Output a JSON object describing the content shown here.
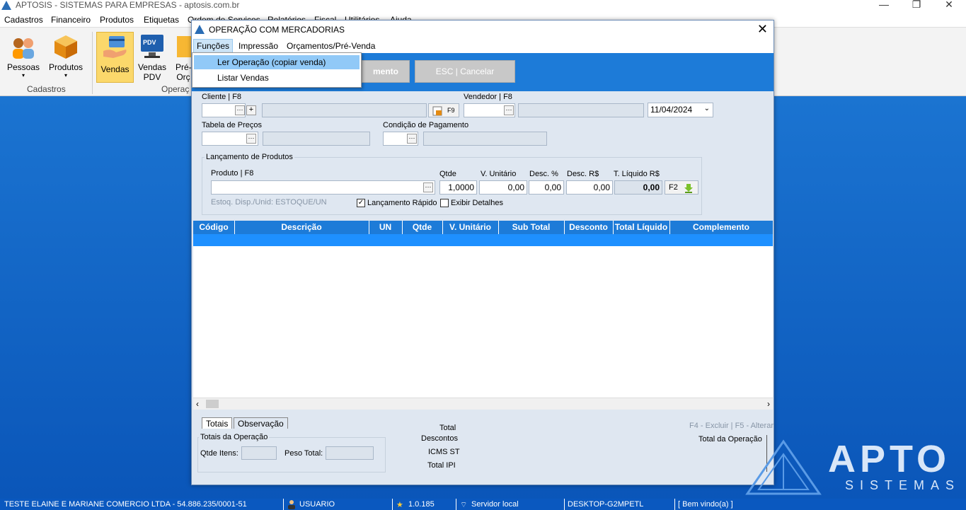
{
  "window": {
    "title": "APTOSIS - SISTEMAS PARA EMPRESAS - aptosis.com.br"
  },
  "menubar": [
    "Cadastros",
    "Financeiro",
    "Produtos",
    "Etiquetas",
    "Ordem de Serviços",
    "Relatórios",
    "Fiscal",
    "Utilitários",
    "Ajuda"
  ],
  "ribbon": {
    "buttons": [
      "Pessoas",
      "Produtos",
      "Vendas",
      "Vendas",
      "PDV",
      "Pré-",
      "Orç"
    ],
    "pdv_icon_text": "PDV",
    "groups": [
      "Cadastros",
      "Operaç"
    ]
  },
  "dialog": {
    "title": "OPERAÇÃO COM MERCADORIAS",
    "menu": [
      "Funções",
      "Impressão",
      "Orçamentos/Pré-Venda"
    ],
    "dropdown": [
      "Ler Operação (copiar venda)",
      "Listar Vendas"
    ],
    "buttons": {
      "payment": "mento",
      "cancel": "ESC | Cancelar"
    },
    "labels": {
      "cliente": "Cliente | F8",
      "vendedor": "Vendedor | F8",
      "tabela": "Tabela de Preços",
      "condicao": "Condição de Pagamento",
      "lancamento": "Lançamento de Produtos",
      "produto": "Produto | F8",
      "qtde": "Qtde",
      "vunit": "V. Unitário",
      "descpct": "Desc. %",
      "descrs": "Desc. R$",
      "tliq": "T. Líquido R$",
      "estoque": "Estoq. Disp./Unid: ESTOQUE/UN",
      "lanc_rapido": "Lançamento Rápido",
      "exibir": "Exibir Detalhes",
      "f9": "F9",
      "f2": "F2",
      "plus": "+",
      "ellipsis": "···"
    },
    "date": "11/04/2024",
    "values": {
      "qtde": "1,0000",
      "vunit": "0,00",
      "descpct": "0,00",
      "descrs": "0,00",
      "tliq": "0,00"
    },
    "grid_columns": [
      "Código",
      "Descrição",
      "UN",
      "Qtde",
      "V. Unitário",
      "Sub Total",
      "Desconto",
      "Total Líquido",
      "Complemento"
    ],
    "tabs": [
      "Totais",
      "Observação"
    ],
    "totals": {
      "group": "Totais da Operação",
      "qtde_itens": "Qtde Itens:",
      "peso_total": "Peso Total:",
      "right_labels": [
        "Total",
        "Descontos",
        "ICMS ST",
        "Total IPI"
      ],
      "shortcuts": "F4 - Excluir | F5 - Alterar",
      "total_operacao": "Total da Operação"
    }
  },
  "statusbar": [
    "TESTE ELAINE E MARIANE COMERCIO LTDA - 54.886.235/0001-51",
    "USUARIO",
    "1.0.185",
    "Servidor local",
    "DESKTOP-G2MPETL",
    "[ Bem vindo(a) ]"
  ],
  "brand": {
    "name": "APTO",
    "sub": "SISTEMAS"
  }
}
